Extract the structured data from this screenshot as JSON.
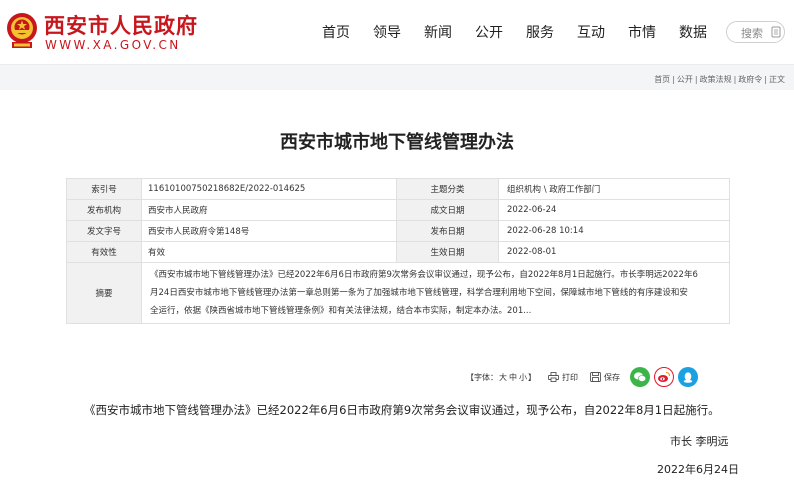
{
  "header": {
    "site_name": "西安市人民政府",
    "site_domain": "WWW.XA.GOV.CN",
    "nav": [
      "首页",
      "领导",
      "新闻",
      "公开",
      "服务",
      "互动",
      "市情",
      "数据"
    ],
    "search_label": "搜索"
  },
  "breadcrumb": [
    "首页",
    "|",
    "公开",
    "|",
    "政策法规",
    "|",
    "政府令",
    "|",
    "正文"
  ],
  "doc_title": "西安市城市地下管线管理办法",
  "info": {
    "index_label": "索引号",
    "index_value": "11610100750218682E/2022-014625",
    "topic_label": "主题分类",
    "topic_value": "组织机构 \\ 政府工作部门",
    "issuer_label": "发布机构",
    "issuer_value": "西安市人民政府",
    "created_label": "成文日期",
    "created_value": "2022-06-24",
    "docno_label": "发文字号",
    "docno_value": "西安市人民政府令第148号",
    "published_label": "发布日期",
    "published_value": "2022-06-28 10:14",
    "validity_label": "有效性",
    "validity_value": "有效",
    "effective_label": "生效日期",
    "effective_value": "2022-08-01",
    "abstract_label": "摘要",
    "abstract_lines": [
      "《西安市城市地下管线管理办法》已经2022年6月6日市政府第9次常务会议审议通过，现予公布，自2022年8月1日起施行。市长李明远2022年6",
      "月24日西安市城市地下管线管理办法第一章总则第一条为了加强城市地下管线管理，科学合理利用地下空间，保障城市地下管线的有序建设和安",
      "全运行，依据《陕西省城市地下管线管理条例》和有关法律法规，结合本市实际，制定本办法。201..."
    ]
  },
  "tools": {
    "font_label": "【字体：",
    "font_large": "大",
    "font_medium": "中",
    "font_small": "小",
    "font_close": "】",
    "print_label": "打印",
    "save_label": "保存"
  },
  "body": {
    "paragraph": "《西安市城市地下管线管理办法》已经2022年6月6日市政府第9次常务会议审议通过，现予公布，自2022年8月1日起施行。",
    "signer": "市长  李明远",
    "sign_date": "2022年6月24日"
  },
  "colors": {
    "brand_red": "#c8161d",
    "wechat_green": "#3bb54a",
    "weibo_orange": "#e6162d",
    "qq_blue": "#1ba0e2"
  }
}
